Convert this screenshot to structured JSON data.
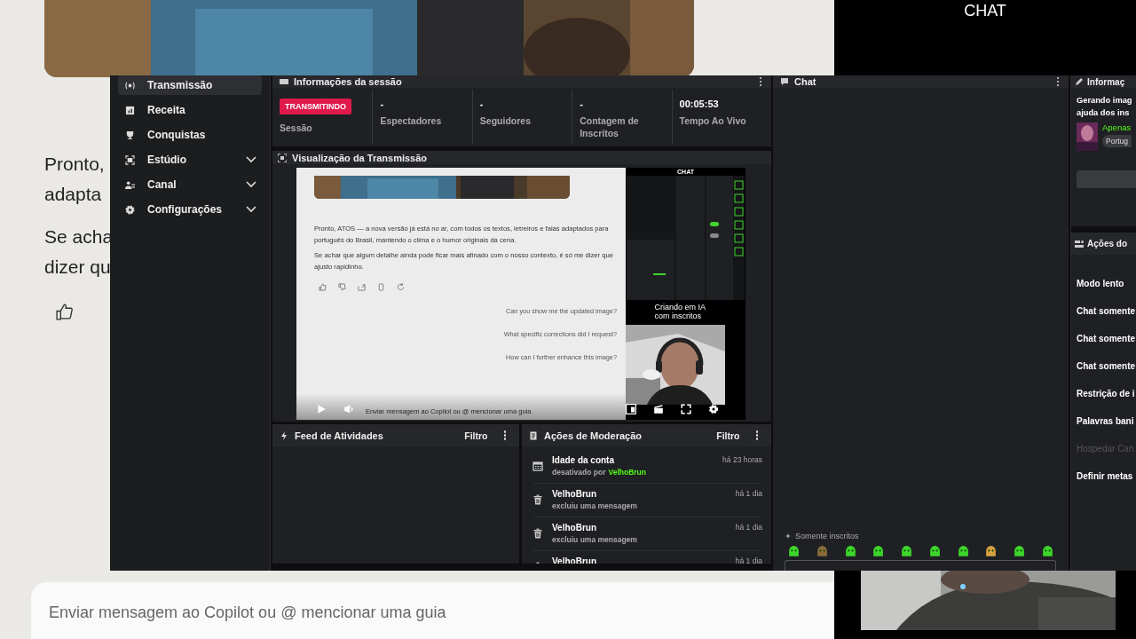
{
  "copilot_page": {
    "message_lines": [
      "Pronto,",
      "adapta",
      "Se acha",
      "dizer qu"
    ],
    "input_placeholder": "Enviar mensagem ao Copilot ou @ mencionar uma guia"
  },
  "overlay_label": "CHAT",
  "dashboard": {
    "sidebar": [
      {
        "label": "Transmissão",
        "selected": true,
        "expandable": false
      },
      {
        "label": "Receita",
        "selected": false,
        "expandable": false
      },
      {
        "label": "Conquistas",
        "selected": false,
        "expandable": false
      },
      {
        "label": "Estúdio",
        "selected": false,
        "expandable": true
      },
      {
        "label": "Canal",
        "selected": false,
        "expandable": true
      },
      {
        "label": "Configurações",
        "selected": false,
        "expandable": true
      }
    ],
    "session_panel": {
      "title": "Informações da sessão",
      "status_badge": "TRANSMITINDO",
      "status_label": "Sessão",
      "stats": [
        {
          "value": "-",
          "label": "Espectadores"
        },
        {
          "value": "-",
          "label": "Seguidores"
        },
        {
          "value": "-",
          "label": "Contagem de Inscritos"
        },
        {
          "value": "00:05:53",
          "label": "Tempo Ao Vivo"
        }
      ]
    },
    "preview": {
      "title": "Visualização da Transmissão",
      "screen": {
        "paragraphs": [
          "Pronto, ATOS — a nova versão já está no ar, com todos os textos, letreiros e falas adaptados para português do Brasil, mantendo o clima e o humor originais da cena.",
          "Se achar que algum detalhe ainda pode ficar mais afinado com o nosso contexto, é só me dizer que ajusto rapidinho."
        ],
        "suggestions": [
          "Can you show me the updated image?",
          "What specific corrections did I request?",
          "How can I further enhance this image?"
        ],
        "input_placeholder": "Enviar mensagem ao Copilot ou @ mencionar uma guia"
      },
      "side_label": "CHAT",
      "caption": "Criando em IA com inscritos"
    },
    "activity_feed": {
      "title": "Feed de Atividades",
      "filter": "Filtro"
    },
    "moderation": {
      "title": "Ações de Moderação",
      "filter": "Filtro",
      "items": [
        {
          "kind": "calendar",
          "title": "Idade da conta",
          "detail": "desativado por",
          "user": "VelhoBrun",
          "time": "há 23 horas"
        },
        {
          "kind": "delete",
          "title": "VelhoBrun",
          "detail": "excluiu uma mensagem",
          "time": "há 1 dia"
        },
        {
          "kind": "delete",
          "title": "VelhoBrun",
          "detail": "excluiu uma mensagem",
          "time": "há 1 dia"
        },
        {
          "kind": "delete",
          "title": "VelhoBrun",
          "time": "há 1 dia"
        }
      ]
    },
    "chat": {
      "title": "Chat",
      "mode_label": "Somente inscritos"
    },
    "stream_info": {
      "title": "Informaç",
      "lines": [
        "Gerando imag",
        "ajuda dos ins"
      ],
      "tag": "Apenas",
      "language": "Portug"
    },
    "chat_actions": {
      "title": "Ações do",
      "items": [
        {
          "label": "Modo lento",
          "disabled": false
        },
        {
          "label": "Chat somente",
          "disabled": false
        },
        {
          "label": "Chat somente",
          "disabled": false
        },
        {
          "label": "Chat somente",
          "disabled": false
        },
        {
          "label": "Restrição de i",
          "disabled": false
        },
        {
          "label": "Palavras bani",
          "disabled": false
        },
        {
          "label": "Hospedar Can",
          "disabled": true
        },
        {
          "label": "Definir metas",
          "disabled": false
        }
      ]
    }
  }
}
